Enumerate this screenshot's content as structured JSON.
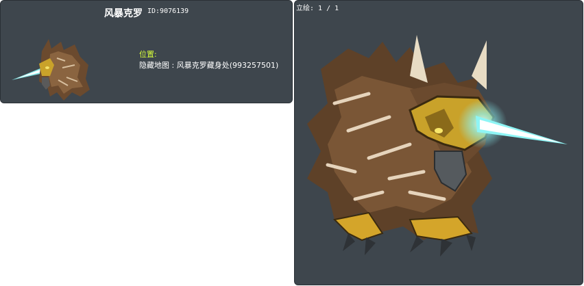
{
  "card": {
    "name": "风暴克罗",
    "id_text": "ID:9076139",
    "location_label": "位置:",
    "location_value": "隐藏地图 : 风暴克罗藏身处(993257501)"
  },
  "illustration": {
    "label": "立绘: 1 / 1"
  },
  "icons": {
    "thumbnail": "griffin-creature-icon",
    "illustration": "griffin-creature-illustration"
  },
  "colors": {
    "panel_bg": "#3e464d",
    "location_label": "#d8ff3a",
    "text": "#ffffff"
  }
}
